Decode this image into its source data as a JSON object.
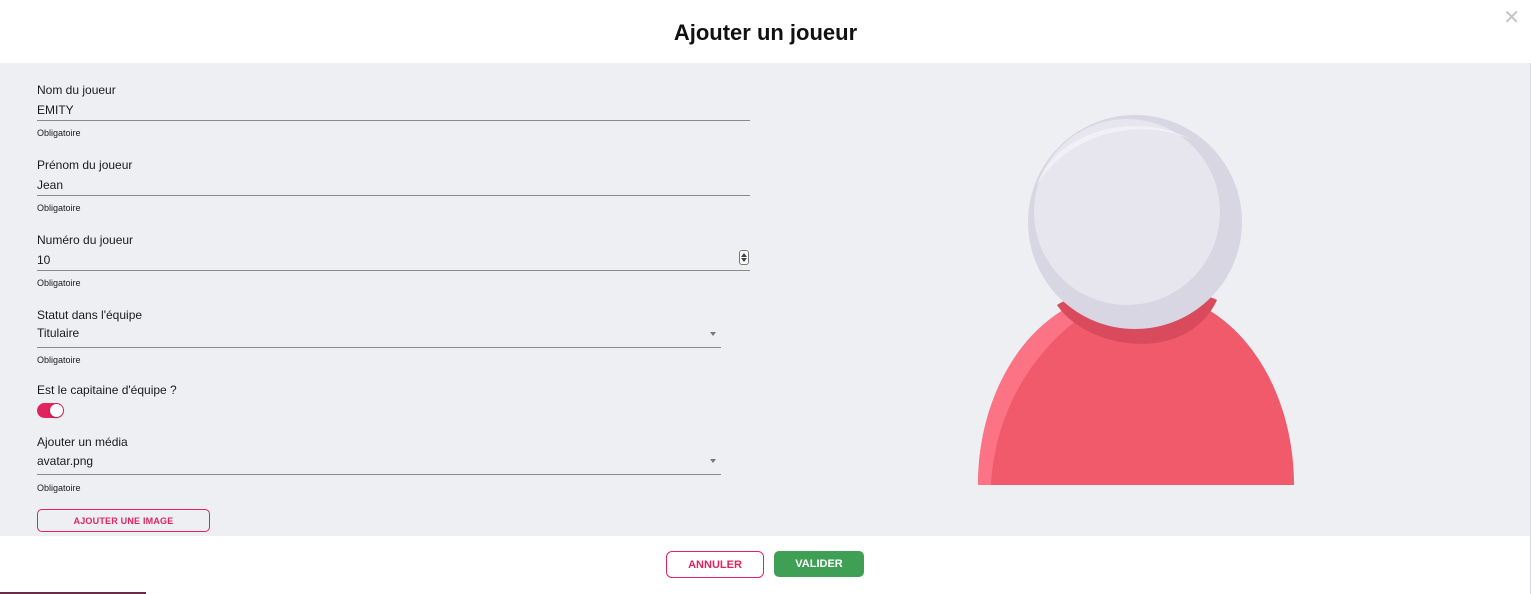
{
  "dialog": {
    "title": "Ajouter un joueur",
    "close_icon": "close-icon"
  },
  "form": {
    "last_name": {
      "label": "Nom du joueur",
      "value": "EMITY",
      "hint": "Obligatoire"
    },
    "first_name": {
      "label": "Prénom du joueur",
      "value": "Jean",
      "hint": "Obligatoire"
    },
    "number": {
      "label": "Numéro du joueur",
      "value": "10",
      "hint": "Obligatoire"
    },
    "status": {
      "label": "Statut dans l'équipe",
      "value": "Titulaire",
      "hint": "Obligatoire"
    },
    "captain": {
      "label": "Est le capitaine d'équipe ?",
      "checked": true
    },
    "media": {
      "label": "Ajouter un média",
      "value": "avatar.png",
      "hint": "Obligatoire"
    },
    "add_image_label": "AJOUTER UNE IMAGE"
  },
  "footer": {
    "cancel_label": "ANNULER",
    "validate_label": "VALIDER"
  },
  "colors": {
    "accent": "#e0245e",
    "validate": "#3f9f55",
    "panel_bg": "#eeeff3",
    "avatar_body": "#f05a6a",
    "avatar_head": "#e6e6ee"
  }
}
